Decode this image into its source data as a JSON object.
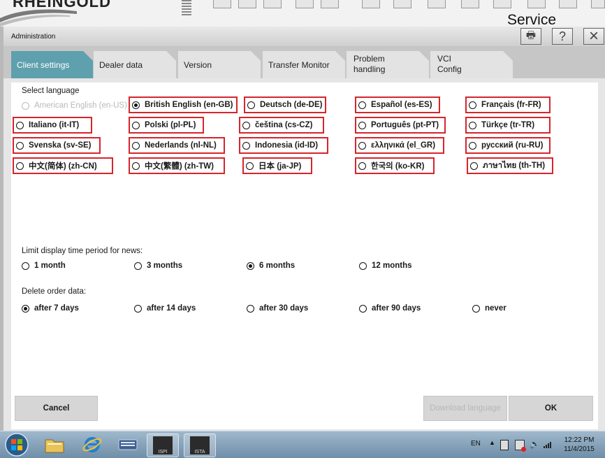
{
  "banner": {
    "brand": "RHEINGOLD",
    "service": "Service"
  },
  "window": {
    "title": "Administration",
    "help_glyph": "?",
    "close_glyph": "×",
    "print_glyph": "🖶"
  },
  "tabs": [
    {
      "label": "Client settings",
      "selected": true
    },
    {
      "label": "Dealer data",
      "selected": false
    },
    {
      "label": "Version",
      "selected": false
    },
    {
      "label": "Transfer Monitor",
      "selected": false
    },
    {
      "label_line1": "Problem",
      "label_line2": "handling",
      "selected": false
    },
    {
      "label_line1": "VCI",
      "label_line2": "Config",
      "selected": false
    }
  ],
  "language": {
    "heading": "Select language",
    "selected": "British English (en-GB)",
    "options": [
      {
        "label": "American English (en-US)",
        "disabled": true
      },
      {
        "label": "British English (en-GB)"
      },
      {
        "label": "Deutsch (de-DE)"
      },
      {
        "label": "Español (es-ES)"
      },
      {
        "label": "Français (fr-FR)"
      },
      {
        "label": "Italiano (it-IT)"
      },
      {
        "label": "Polski (pl-PL)"
      },
      {
        "label": "čeština (cs-CZ)"
      },
      {
        "label": "Português (pt-PT)"
      },
      {
        "label": "Türkçe (tr-TR)"
      },
      {
        "label": "Svenska (sv-SE)"
      },
      {
        "label": "Nederlands (nl-NL)"
      },
      {
        "label": "Indonesia (id-ID)"
      },
      {
        "label": "ελληνικά (el_GR)"
      },
      {
        "label": "русский (ru-RU)"
      },
      {
        "label": "中文(简体) (zh-CN)"
      },
      {
        "label": "中文(繁體) (zh-TW)"
      },
      {
        "label": "日本 (ja-JP)"
      },
      {
        "label": "한국의 (ko-KR)"
      },
      {
        "label": "ภาษาไทย (th-TH)"
      }
    ]
  },
  "news_period": {
    "heading": "Limit display time period for news:",
    "selected": "6 months",
    "options": [
      "1 month",
      "3 months",
      "6 months",
      "12 months"
    ]
  },
  "delete_order": {
    "heading": "Delete order data:",
    "selected": "after 7 days",
    "options": [
      "after 7 days",
      "after 14 days",
      "after 30 days",
      "after 90 days",
      "never"
    ]
  },
  "buttons": {
    "cancel": "Cancel",
    "download": "Download language",
    "ok": "OK"
  },
  "taskbar": {
    "lang": "EN",
    "time": "12:22 PM",
    "date": "11/4/2015",
    "app1": "ISPI",
    "app2": "ISTA"
  },
  "colors": {
    "tab_selected": "#5ea0ad",
    "highlight_box": "#d6252b",
    "taskbar": "#7f9db5"
  }
}
